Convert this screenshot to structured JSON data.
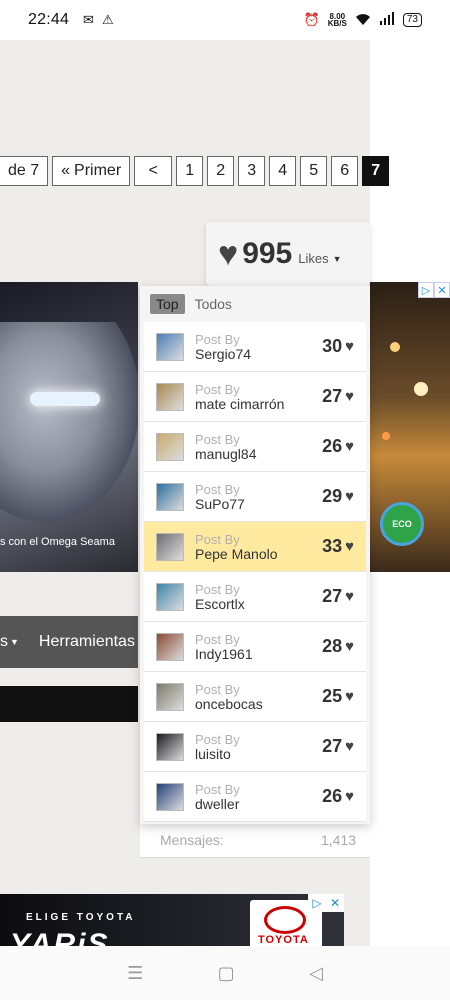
{
  "status_bar": {
    "time": "22:44",
    "speed_value": "8.00",
    "speed_unit": "KB/S",
    "battery": "73"
  },
  "pagination": {
    "of_label": "de 7",
    "first_label": "Primer",
    "prev_label": "<",
    "pages": [
      "1",
      "2",
      "3",
      "4",
      "5",
      "6",
      "7"
    ],
    "current": "7"
  },
  "likes": {
    "count": "995",
    "label": "Likes"
  },
  "dropdown": {
    "tab_top": "Top",
    "tab_all": "Todos",
    "post_by_label": "Post By",
    "entries": [
      {
        "user": "Sergio74",
        "score": "30",
        "avatar_color": "#4a7fb8",
        "highlight": false
      },
      {
        "user": "mate cimarrón",
        "score": "27",
        "avatar_color": "#a88a52",
        "highlight": false
      },
      {
        "user": "manugl84",
        "score": "26",
        "avatar_color": "#c7a96c",
        "highlight": false
      },
      {
        "user": "SuPo77",
        "score": "29",
        "avatar_color": "#2e6f9e",
        "highlight": false
      },
      {
        "user": "Pepe Manolo",
        "score": "33",
        "avatar_color": "#6e6e72",
        "highlight": true
      },
      {
        "user": "Escortlx",
        "score": "27",
        "avatar_color": "#3b86a8",
        "highlight": false
      },
      {
        "user": "Indy1961",
        "score": "28",
        "avatar_color": "#8a4a32",
        "highlight": false
      },
      {
        "user": "oncebocas",
        "score": "25",
        "avatar_color": "#7c7c6c",
        "highlight": false
      },
      {
        "user": "luisito",
        "score": "27",
        "avatar_color": "#1a1a1e",
        "highlight": false
      },
      {
        "user": "dweller",
        "score": "26",
        "avatar_color": "#24407a",
        "highlight": false
      }
    ]
  },
  "nav": {
    "item1": "s",
    "item2": "Herramientas"
  },
  "mensajes": {
    "label": "Mensajes:",
    "value": "1,413"
  },
  "ads": {
    "car_caption": "s con el Omega Seama",
    "toyota_tag": "ELIGE TOYOTA",
    "toyota_model": "YARiS",
    "toyota_brand": "TOYOTA",
    "eco_label": "ECO"
  },
  "colors": {
    "highlight_row": "#ffeaa0",
    "active_page": "#111111"
  }
}
